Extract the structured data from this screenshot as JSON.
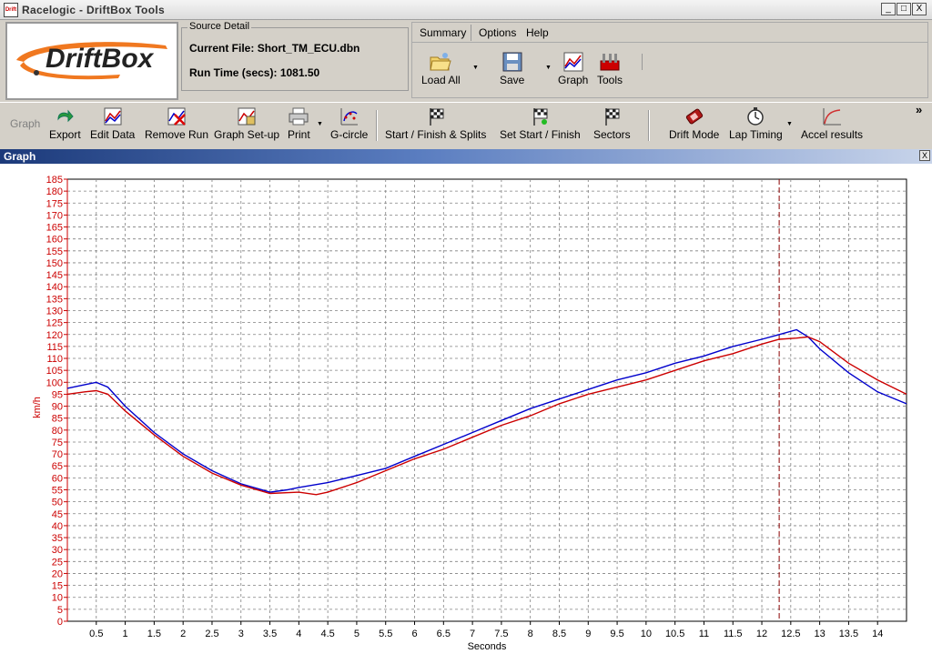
{
  "window": {
    "title": "Racelogic - DriftBox Tools",
    "icon_text": "Drift",
    "controls": [
      "_",
      "□",
      "X"
    ]
  },
  "logo": {
    "text": "DriftBox",
    "accent": "#f07820"
  },
  "source": {
    "legend": "Source Detail",
    "file_label": "Current File:",
    "file_value": "Short_TM_ECU.dbn",
    "runtime_label": "Run Time (secs):",
    "runtime_value": "1081.50"
  },
  "menu": {
    "items": [
      "Summary",
      "Options",
      "Help"
    ],
    "tools": [
      {
        "label": "Load All",
        "icon": "folder-icon",
        "dropdown": true
      },
      {
        "label": "Save",
        "icon": "floppy-icon",
        "dropdown": true
      },
      {
        "label": "Graph",
        "icon": "graph-icon",
        "dropdown": false
      },
      {
        "label": "Tools",
        "icon": "tools-icon",
        "dropdown": false
      }
    ]
  },
  "toolbar": {
    "group_label": "Graph",
    "items": [
      {
        "label": "Export",
        "icon": "export-arrow-icon"
      },
      {
        "label": "Edit Data",
        "icon": "edit-data-icon"
      },
      {
        "label": "Remove Run",
        "icon": "remove-run-icon"
      },
      {
        "label": "Graph Set-up",
        "icon": "graph-setup-icon"
      },
      {
        "label": "Print",
        "icon": "printer-icon",
        "dropdown": true
      },
      {
        "label": "G-circle",
        "icon": "g-circle-icon"
      },
      {
        "label": "Start / Finish & Splits",
        "icon": "checkered-flag-icon"
      },
      {
        "label": "Set Start / Finish",
        "icon": "checkered-flag-green-icon"
      },
      {
        "label": "Sectors",
        "icon": "checkered-flag-icon"
      },
      {
        "label": "Drift Mode",
        "icon": "drift-car-icon"
      },
      {
        "label": "Lap Timing",
        "icon": "stopwatch-icon",
        "dropdown": true
      },
      {
        "label": "Accel results",
        "icon": "accel-curve-icon"
      }
    ],
    "overflow": "»"
  },
  "graph_panel": {
    "title": "Graph",
    "close": "X"
  },
  "chart_data": {
    "type": "line",
    "xlabel": "Seconds",
    "ylabel": "km/h",
    "xlim": [
      0,
      14.5
    ],
    "ylim": [
      0,
      185
    ],
    "y_ticks": [
      0,
      5,
      10,
      15,
      20,
      25,
      30,
      35,
      40,
      45,
      50,
      55,
      60,
      65,
      70,
      75,
      80,
      85,
      90,
      95,
      100,
      105,
      110,
      115,
      120,
      125,
      130,
      135,
      140,
      145,
      150,
      155,
      160,
      165,
      170,
      175,
      180,
      185
    ],
    "x_ticks": [
      "0.5",
      "1",
      "1.5",
      "2",
      "2.5",
      "3",
      "3.5",
      "4",
      "4.5",
      "5",
      "5.5",
      "6",
      "6.5",
      "7",
      "7.5",
      "8",
      "8.5",
      "9",
      "9.5",
      "10",
      "10.5",
      "11",
      "11.5",
      "12",
      "12.5",
      "13",
      "13.5",
      "14"
    ],
    "x_tick_values": [
      0.5,
      1,
      1.5,
      2,
      2.5,
      3,
      3.5,
      4,
      4.5,
      5,
      5.5,
      6,
      6.5,
      7,
      7.5,
      8,
      8.5,
      9,
      9.5,
      10,
      10.5,
      11,
      11.5,
      12,
      12.5,
      13,
      13.5,
      14
    ],
    "grid": true,
    "cursor_x": 12.3,
    "colors": {
      "axis": "#cc0000",
      "grid": "#808080",
      "cursor": "#8b0000"
    },
    "series": [
      {
        "color": "#0000cc",
        "x": [
          0,
          0.3,
          0.5,
          0.7,
          1.0,
          1.5,
          2.0,
          2.5,
          3.0,
          3.5,
          3.8,
          4.0,
          4.5,
          5.0,
          5.5,
          6.0,
          6.5,
          7.0,
          7.5,
          8.0,
          8.5,
          9.0,
          9.5,
          10.0,
          10.5,
          11.0,
          11.5,
          12.0,
          12.3,
          12.6,
          12.8,
          13.0,
          13.5,
          14.0,
          14.5
        ],
        "y": [
          97.5,
          99,
          100,
          98,
          90,
          79,
          70,
          63,
          57.5,
          54,
          55,
          56,
          58,
          61,
          64,
          69,
          74,
          79,
          84,
          89,
          93,
          97,
          101,
          104,
          108,
          111,
          115,
          118,
          120,
          122,
          119,
          114,
          104,
          96,
          91
        ]
      },
      {
        "color": "#cc0000",
        "x": [
          0,
          0.3,
          0.5,
          0.7,
          1.0,
          1.5,
          2.0,
          2.5,
          3.0,
          3.5,
          4.0,
          4.3,
          4.5,
          5.0,
          5.5,
          6.0,
          6.5,
          7.0,
          7.5,
          8.0,
          8.5,
          9.0,
          9.5,
          10.0,
          10.5,
          11.0,
          11.5,
          12.0,
          12.3,
          12.6,
          12.8,
          13.0,
          13.5,
          14.0,
          14.5
        ],
        "y": [
          95,
          96,
          96.5,
          95,
          88,
          78,
          69,
          62,
          57,
          53.5,
          54,
          53,
          54,
          58,
          63,
          68,
          72,
          77,
          82,
          86,
          91,
          95,
          98,
          101,
          105,
          109,
          112,
          116,
          118,
          118.5,
          119,
          117,
          108,
          101,
          95
        ]
      }
    ]
  }
}
